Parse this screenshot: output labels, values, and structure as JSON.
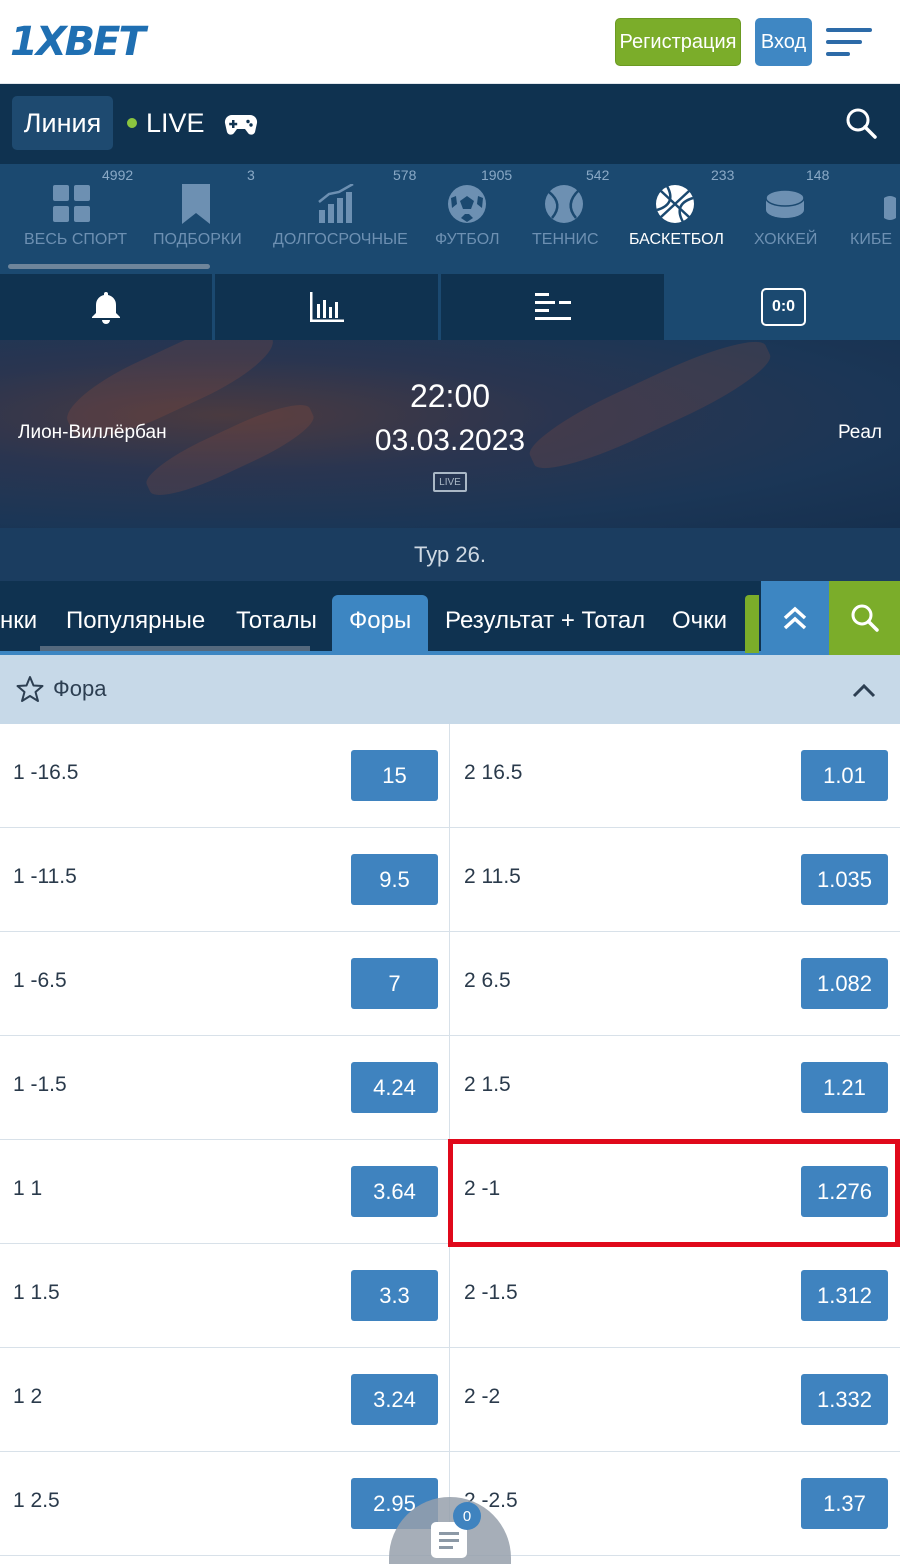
{
  "header": {
    "logo": "1XBET",
    "register_label": "Регистрация",
    "login_label": "Вход"
  },
  "nav": {
    "line_label": "Линия",
    "live_label": "LIVE"
  },
  "sports": [
    {
      "label": "ВЕСЬ СПОРТ",
      "count": "4992"
    },
    {
      "label": "ПОДБОРКИ",
      "count": "3"
    },
    {
      "label": "ДОЛГОСРОЧНЫЕ",
      "count": "578"
    },
    {
      "label": "ФУТБОЛ",
      "count": "1905"
    },
    {
      "label": "ТЕННИС",
      "count": "542"
    },
    {
      "label": "БАСКЕТБОЛ",
      "count": "233",
      "active": true
    },
    {
      "label": "ХОККЕЙ",
      "count": "148"
    },
    {
      "label": "КИБЕ",
      "count": ""
    }
  ],
  "match": {
    "team1": "Лион-Виллёрбан",
    "team2": "Реал",
    "time": "22:00",
    "date": "03.03.2023",
    "live_badge": "LIVE",
    "score": "0:0",
    "round": "Тур 26."
  },
  "market_tabs": [
    {
      "label": "нки"
    },
    {
      "label": "Популярные"
    },
    {
      "label": "Тоталы"
    },
    {
      "label": "Форы",
      "active": true
    },
    {
      "label": "Результат + Тотал"
    },
    {
      "label": "Очки"
    }
  ],
  "market": {
    "title": "Фора",
    "rows": [
      {
        "l_label": "1 -16.5",
        "l_odd": "15",
        "r_label": "2 16.5",
        "r_odd": "1.01"
      },
      {
        "l_label": "1 -11.5",
        "l_odd": "9.5",
        "r_label": "2 11.5",
        "r_odd": "1.035"
      },
      {
        "l_label": "1 -6.5",
        "l_odd": "7",
        "r_label": "2 6.5",
        "r_odd": "1.082"
      },
      {
        "l_label": "1 -1.5",
        "l_odd": "4.24",
        "r_label": "2 1.5",
        "r_odd": "1.21"
      },
      {
        "l_label": "1 1",
        "l_odd": "3.64",
        "r_label": "2 -1",
        "r_odd": "1.276"
      },
      {
        "l_label": "1 1.5",
        "l_odd": "3.3",
        "r_label": "2 -1.5",
        "r_odd": "1.312"
      },
      {
        "l_label": "1 2",
        "l_odd": "3.24",
        "r_label": "2 -2",
        "r_odd": "1.332"
      },
      {
        "l_label": "1 2.5",
        "l_odd": "2.95",
        "r_label": "2 -2.5",
        "r_odd": "1.37"
      }
    ]
  },
  "betslip": {
    "count": "0"
  },
  "colors": {
    "brand_blue": "#1f6fb2",
    "nav_dark": "#0f3250",
    "accent_green": "#7bad2a",
    "odd_button": "#3f83bf",
    "highlight_red": "#e0091b"
  },
  "icons": {
    "menu": "hamburger-icon",
    "games": "gamepad-icon",
    "search": "search-icon",
    "notify": "bell-icon",
    "stats": "bar-chart-icon",
    "markets": "list-icon",
    "favorite": "star-icon",
    "collapse": "chevron-up-icon",
    "scroll_top": "double-chevron-up-icon",
    "betslip": "document-icon"
  }
}
